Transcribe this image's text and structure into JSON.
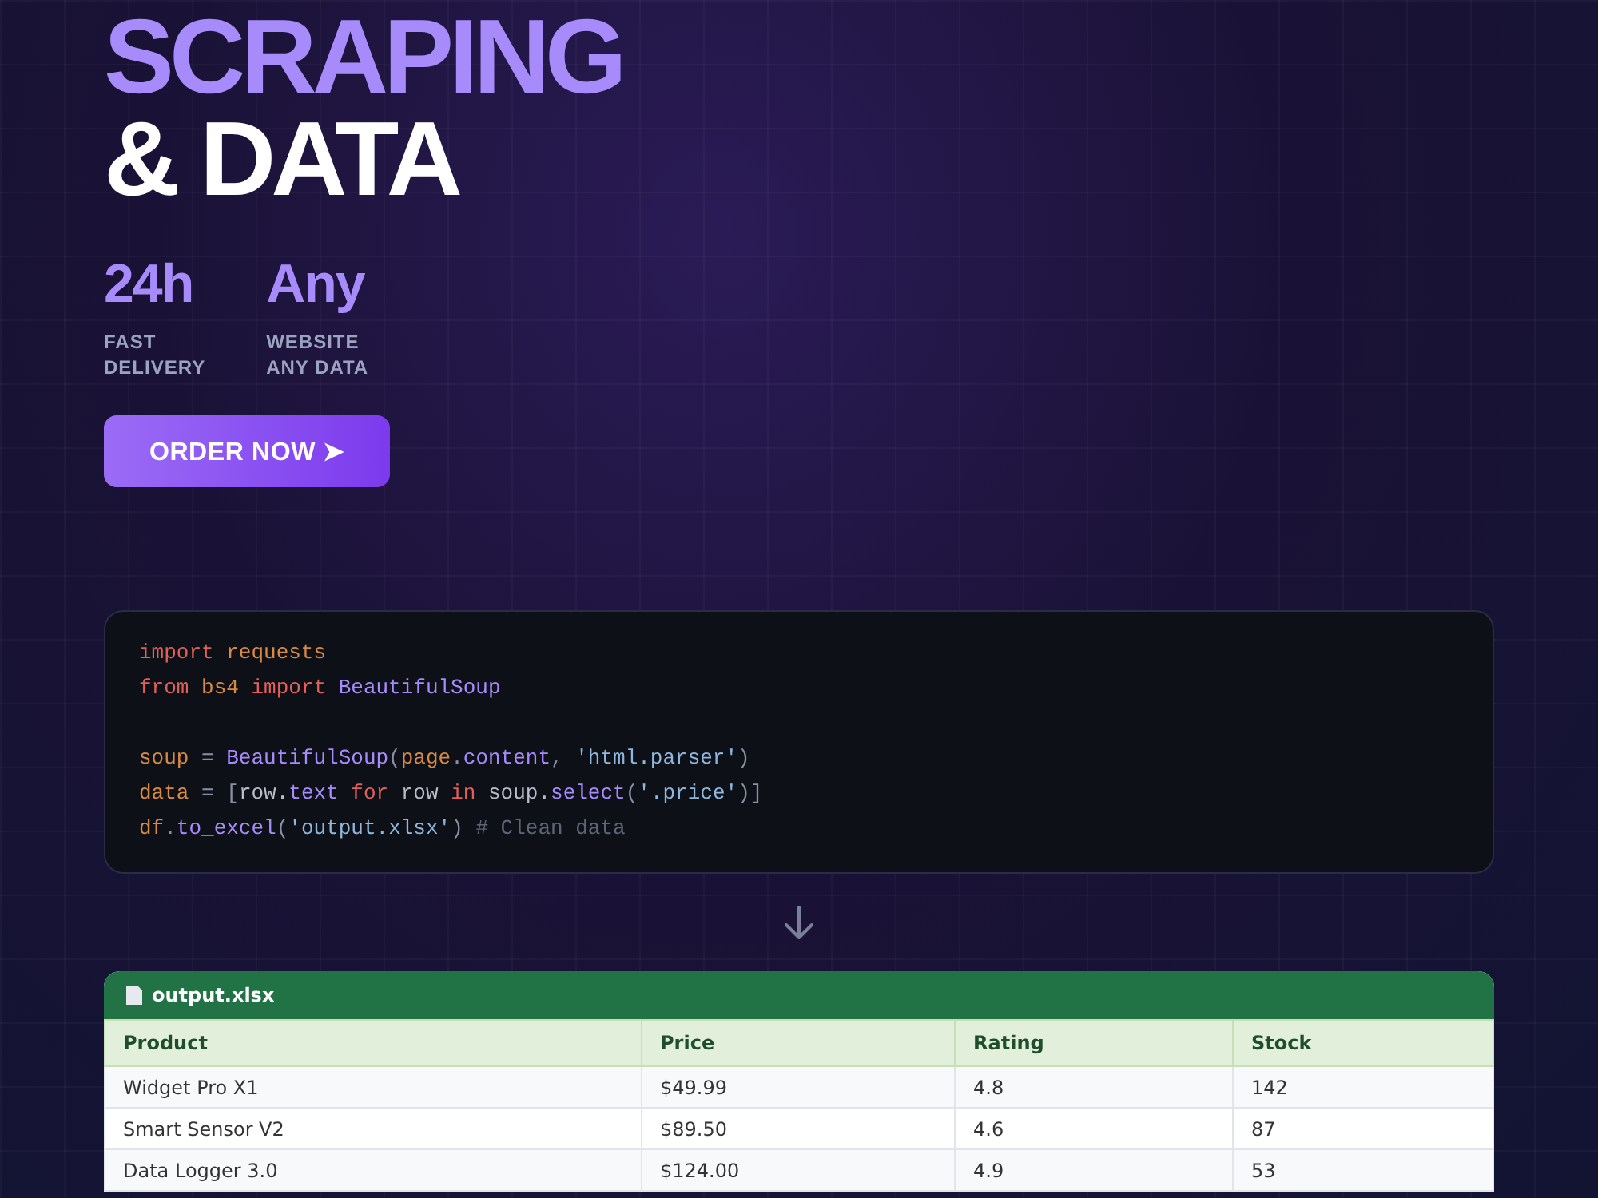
{
  "hero": {
    "title_line_1": "SCRAPING",
    "title_line_2": "& DATA",
    "stats": [
      {
        "value": "24h",
        "label_lines": [
          "FAST",
          "DELIVERY"
        ]
      },
      {
        "value": "Any",
        "label_lines": [
          "WEBSITE",
          "ANY DATA"
        ]
      }
    ],
    "button": "ORDER NOW ➤"
  },
  "code": {
    "lines": [
      {
        "tokens": [
          {
            "kind": "keyword",
            "text": "import "
          },
          {
            "kind": "name",
            "text": "requests"
          }
        ]
      },
      {
        "tokens": [
          {
            "kind": "keyword",
            "text": "from "
          },
          {
            "kind": "name",
            "text": "bs4 "
          },
          {
            "kind": "keyword",
            "text": "import "
          },
          {
            "kind": "class",
            "text": "BeautifulSoup"
          }
        ]
      },
      {
        "gap_before": true,
        "tokens": [
          {
            "kind": "name",
            "text": "soup"
          },
          {
            "kind": "punct",
            "text": " = "
          },
          {
            "kind": "class",
            "text": "BeautifulSoup"
          },
          {
            "kind": "punct",
            "text": "("
          },
          {
            "kind": "name",
            "text": "page"
          },
          {
            "kind": "punct",
            "text": "."
          },
          {
            "kind": "attr",
            "text": "content"
          },
          {
            "kind": "punct",
            "text": ", "
          },
          {
            "kind": "string",
            "text": "'html.parser'"
          },
          {
            "kind": "punct",
            "text": ")"
          }
        ]
      },
      {
        "tokens": [
          {
            "kind": "name",
            "text": "data"
          },
          {
            "kind": "punct",
            "text": " = ["
          },
          {
            "kind": "plain",
            "text": "row."
          },
          {
            "kind": "attr",
            "text": "text "
          },
          {
            "kind": "keyword",
            "text": "for"
          },
          {
            "kind": "plain",
            "text": " row "
          },
          {
            "kind": "keyword",
            "text": "in"
          },
          {
            "kind": "plain",
            "text": " soup."
          },
          {
            "kind": "attr",
            "text": "select"
          },
          {
            "kind": "punct",
            "text": "("
          },
          {
            "kind": "string",
            "text": "'.price'"
          },
          {
            "kind": "punct",
            "text": ")]"
          }
        ]
      },
      {
        "tokens": [
          {
            "kind": "name",
            "text": "df"
          },
          {
            "kind": "punct",
            "text": "."
          },
          {
            "kind": "attr",
            "text": "to_excel"
          },
          {
            "kind": "punct",
            "text": "("
          },
          {
            "kind": "string",
            "text": "'output.xlsx'"
          },
          {
            "kind": "punct",
            "text": ") "
          },
          {
            "kind": "comment",
            "text": "# Clean data"
          }
        ]
      }
    ]
  },
  "sheet": {
    "filename": "output.xlsx",
    "columns": [
      "Product",
      "Price",
      "Rating",
      "Stock"
    ],
    "rows": [
      [
        "Widget Pro X1",
        "$49.99",
        "4.8",
        "142"
      ],
      [
        "Smart Sensor V2",
        "$89.50",
        "4.6",
        "87"
      ],
      [
        "Data Logger 3.0",
        "$124.00",
        "4.9",
        "53"
      ]
    ]
  }
}
